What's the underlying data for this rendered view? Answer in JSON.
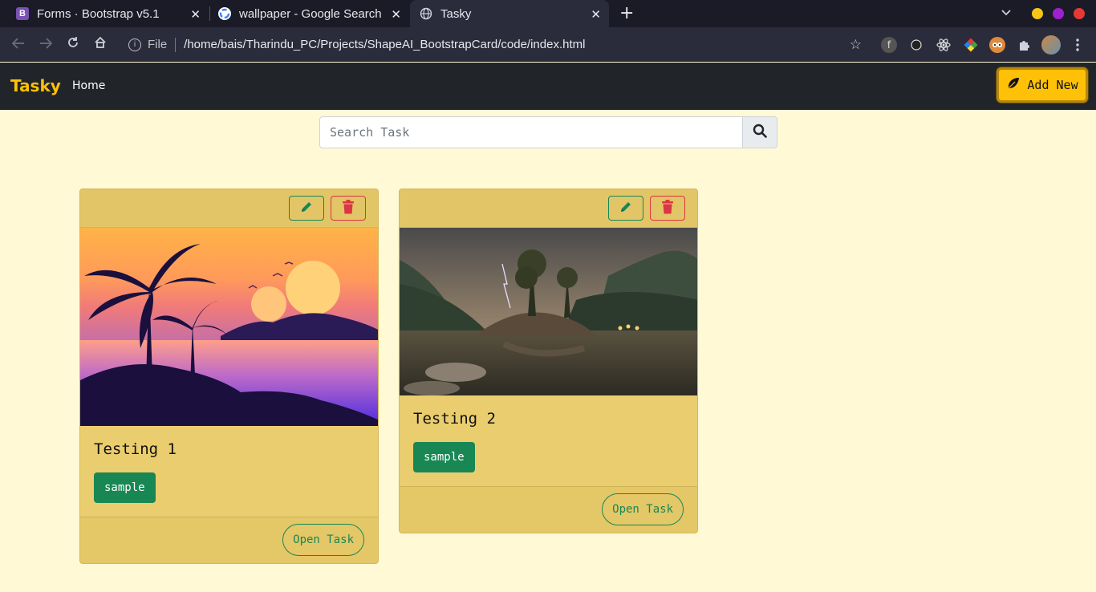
{
  "browser": {
    "tabs": [
      {
        "title": "Forms · Bootstrap v5.1",
        "favicon": "bootstrap-icon"
      },
      {
        "title": "wallpaper - Google Search",
        "favicon": "google-icon"
      },
      {
        "title": "Tasky",
        "favicon": "globe-icon"
      }
    ],
    "close_glyph": "✕",
    "new_tab_glyph": "+",
    "address": {
      "scheme_label": "File",
      "path": "/home/bais/Tharindu_PC/Projects/ShapeAI_BootstrapCard/code/index.html"
    },
    "window_dots": [
      "#f5c518",
      "#a020d0",
      "#e53935"
    ]
  },
  "navbar": {
    "brand": "Tasky",
    "links": [
      "Home"
    ],
    "add_button_label": "Add New",
    "brand_color": "#ffc107"
  },
  "search": {
    "placeholder": "Search Task",
    "value": ""
  },
  "cards": [
    {
      "title": "Testing 1",
      "tag": "sample",
      "open_label": "Open Task",
      "image": "sunset-palm-illustration"
    },
    {
      "title": "Testing 2",
      "tag": "sample",
      "open_label": "Open Task",
      "image": "mountain-lake-storm-photo"
    }
  ],
  "colors": {
    "page_bg": "#fff9d6",
    "card_bg": "#eacd6e",
    "success": "#198754",
    "danger": "#dc3545"
  }
}
